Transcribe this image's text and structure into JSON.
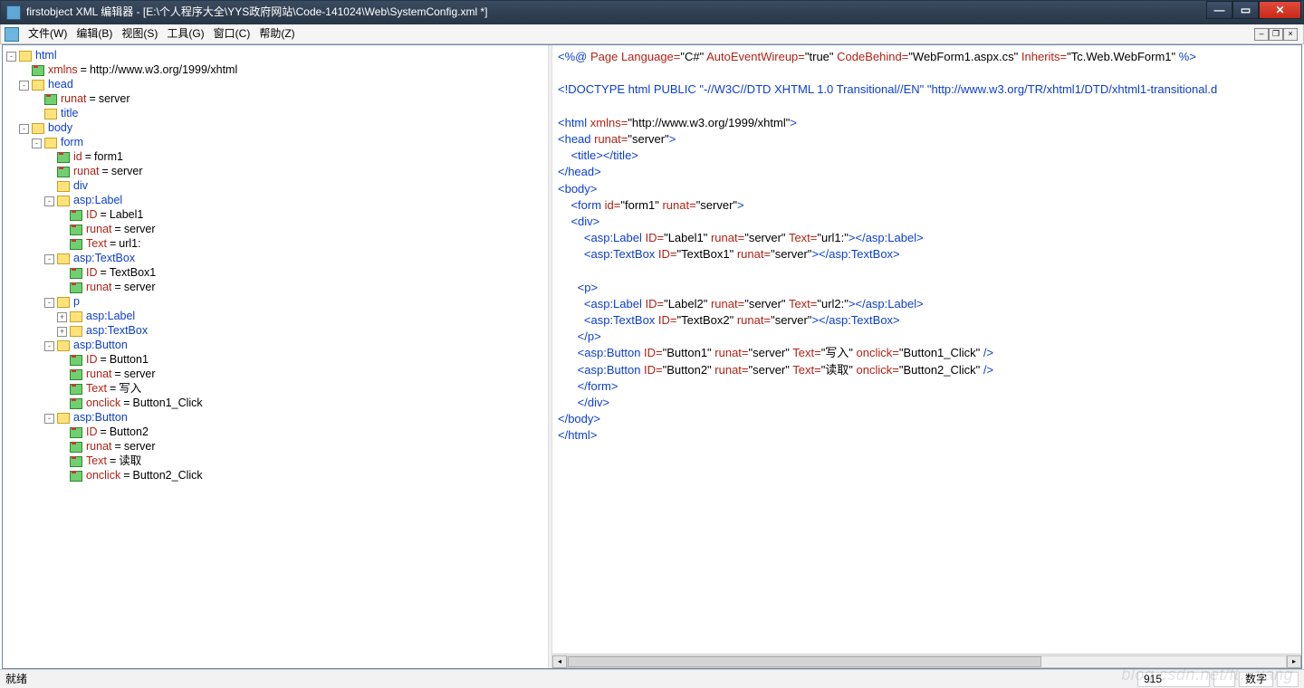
{
  "title": "firstobject XML 编辑器 - [E:\\个人程序大全\\YYS政府网站\\Code-141024\\Web\\SystemConfig.xml *]",
  "menu": {
    "file": "文件(W)",
    "edit": "编辑(B)",
    "view": "视图(S)",
    "tools": "工具(G)",
    "window": "窗口(C)",
    "help": "帮助(Z)"
  },
  "status": {
    "ready": "就绪",
    "num": "数字",
    "pos": "915"
  },
  "tree": [
    {
      "d": 0,
      "t": "el",
      "tog": "-",
      "n": "html"
    },
    {
      "d": 1,
      "t": "at",
      "n": "xmlns",
      "v": "http://www.w3.org/1999/xhtml"
    },
    {
      "d": 1,
      "t": "el",
      "tog": "-",
      "n": "head"
    },
    {
      "d": 2,
      "t": "at",
      "n": "runat",
      "v": "server"
    },
    {
      "d": 2,
      "t": "el",
      "n": "title"
    },
    {
      "d": 1,
      "t": "el",
      "tog": "-",
      "n": "body"
    },
    {
      "d": 2,
      "t": "el",
      "tog": "-",
      "n": "form"
    },
    {
      "d": 3,
      "t": "at",
      "n": "id",
      "v": "form1"
    },
    {
      "d": 3,
      "t": "at",
      "n": "runat",
      "v": "server"
    },
    {
      "d": 3,
      "t": "el",
      "n": "div"
    },
    {
      "d": 3,
      "t": "el",
      "tog": "-",
      "n": "asp:Label"
    },
    {
      "d": 4,
      "t": "at",
      "n": "ID",
      "v": "Label1"
    },
    {
      "d": 4,
      "t": "at",
      "n": "runat",
      "v": "server"
    },
    {
      "d": 4,
      "t": "at",
      "n": "Text",
      "v": "url1:"
    },
    {
      "d": 3,
      "t": "el",
      "tog": "-",
      "n": "asp:TextBox"
    },
    {
      "d": 4,
      "t": "at",
      "n": "ID",
      "v": "TextBox1"
    },
    {
      "d": 4,
      "t": "at",
      "n": "runat",
      "v": "server"
    },
    {
      "d": 3,
      "t": "el",
      "tog": "-",
      "n": "p"
    },
    {
      "d": 4,
      "t": "el",
      "tog": "+",
      "n": "asp:Label"
    },
    {
      "d": 4,
      "t": "el",
      "tog": "+",
      "n": "asp:TextBox"
    },
    {
      "d": 3,
      "t": "el",
      "tog": "-",
      "n": "asp:Button"
    },
    {
      "d": 4,
      "t": "at",
      "n": "ID",
      "v": "Button1"
    },
    {
      "d": 4,
      "t": "at",
      "n": "runat",
      "v": "server"
    },
    {
      "d": 4,
      "t": "at",
      "n": "Text",
      "v": "写入"
    },
    {
      "d": 4,
      "t": "at",
      "n": "onclick",
      "v": "Button1_Click"
    },
    {
      "d": 3,
      "t": "el",
      "tog": "-",
      "n": "asp:Button"
    },
    {
      "d": 4,
      "t": "at",
      "n": "ID",
      "v": "Button2"
    },
    {
      "d": 4,
      "t": "at",
      "n": "runat",
      "v": "server"
    },
    {
      "d": 4,
      "t": "at",
      "n": "Text",
      "v": "读取"
    },
    {
      "d": 4,
      "t": "at",
      "n": "onclick",
      "v": "Button2_Click"
    }
  ],
  "code": [
    [
      [
        "tag",
        "<%@ "
      ],
      [
        "attr",
        "Page Language="
      ],
      [
        "str",
        "\"C#\" "
      ],
      [
        "attr",
        "AutoEventWireup="
      ],
      [
        "str",
        "\"true\" "
      ],
      [
        "attr",
        "CodeBehind="
      ],
      [
        "str",
        "\"WebForm1.aspx.cs\" "
      ],
      [
        "attr",
        "Inherits="
      ],
      [
        "str",
        "\"Tc.Web.WebForm1\" "
      ],
      [
        "tag",
        "%>"
      ]
    ],
    [],
    [
      [
        "tag",
        "<!DOCTYPE html PUBLIC \"-//W3C//DTD XHTML 1.0 Transitional//EN\" \"http://www.w3.org/TR/xhtml1/DTD/xhtml1-transitional.d"
      ]
    ],
    [],
    [
      [
        "tag",
        "<html "
      ],
      [
        "attr",
        "xmlns="
      ],
      [
        "str",
        "\"http://www.w3.org/1999/xhtml\""
      ],
      [
        "tag",
        ">"
      ]
    ],
    [
      [
        "tag",
        "<head "
      ],
      [
        "attr",
        "runat="
      ],
      [
        "str",
        "\"server\""
      ],
      [
        "tag",
        ">"
      ]
    ],
    [
      [
        "tag",
        "    <title></title>"
      ]
    ],
    [
      [
        "tag",
        "</head>"
      ]
    ],
    [
      [
        "tag",
        "<body>"
      ]
    ],
    [
      [
        "tag",
        "    <form "
      ],
      [
        "attr",
        "id="
      ],
      [
        "str",
        "\"form1\" "
      ],
      [
        "attr",
        "runat="
      ],
      [
        "str",
        "\"server\""
      ],
      [
        "tag",
        ">"
      ]
    ],
    [
      [
        "tag",
        "    <div>"
      ]
    ],
    [
      [
        "tag",
        "        <asp:Label "
      ],
      [
        "attr",
        "ID="
      ],
      [
        "str",
        "\"Label1\" "
      ],
      [
        "attr",
        "runat="
      ],
      [
        "str",
        "\"server\" "
      ],
      [
        "attr",
        "Text="
      ],
      [
        "str",
        "\"url1:\""
      ],
      [
        "tag",
        "></asp:Label>"
      ]
    ],
    [
      [
        "tag",
        "        <asp:TextBox "
      ],
      [
        "attr",
        "ID="
      ],
      [
        "str",
        "\"TextBox1\" "
      ],
      [
        "attr",
        "runat="
      ],
      [
        "str",
        "\"server\""
      ],
      [
        "tag",
        "></asp:TextBox>"
      ]
    ],
    [],
    [
      [
        "tag",
        "      <p>"
      ]
    ],
    [
      [
        "tag",
        "        <asp:Label "
      ],
      [
        "attr",
        "ID="
      ],
      [
        "str",
        "\"Label2\" "
      ],
      [
        "attr",
        "runat="
      ],
      [
        "str",
        "\"server\" "
      ],
      [
        "attr",
        "Text="
      ],
      [
        "str",
        "\"url2:\""
      ],
      [
        "tag",
        "></asp:Label>"
      ]
    ],
    [
      [
        "tag",
        "        <asp:TextBox "
      ],
      [
        "attr",
        "ID="
      ],
      [
        "str",
        "\"TextBox2\" "
      ],
      [
        "attr",
        "runat="
      ],
      [
        "str",
        "\"server\""
      ],
      [
        "tag",
        "></asp:TextBox>"
      ]
    ],
    [
      [
        "tag",
        "      </p>"
      ]
    ],
    [
      [
        "tag",
        "      <asp:Button "
      ],
      [
        "attr",
        "ID="
      ],
      [
        "str",
        "\"Button1\" "
      ],
      [
        "attr",
        "runat="
      ],
      [
        "str",
        "\"server\" "
      ],
      [
        "attr",
        "Text="
      ],
      [
        "str",
        "\"写入\" "
      ],
      [
        "attr",
        "onclick="
      ],
      [
        "str",
        "\"Button1_Click\""
      ],
      [
        "tag",
        " />"
      ]
    ],
    [
      [
        "tag",
        "      <asp:Button "
      ],
      [
        "attr",
        "ID="
      ],
      [
        "str",
        "\"Button2\" "
      ],
      [
        "attr",
        "runat="
      ],
      [
        "str",
        "\"server\" "
      ],
      [
        "attr",
        "Text="
      ],
      [
        "str",
        "\"读取\" "
      ],
      [
        "attr",
        "onclick="
      ],
      [
        "str",
        "\"Button2_Click\""
      ],
      [
        "tag",
        " />"
      ]
    ],
    [
      [
        "tag",
        "      </form>"
      ]
    ],
    [
      [
        "tag",
        "      </div>"
      ]
    ],
    [
      [
        "tag",
        "</body>"
      ]
    ],
    [
      [
        "tag",
        "</html>"
      ]
    ]
  ]
}
